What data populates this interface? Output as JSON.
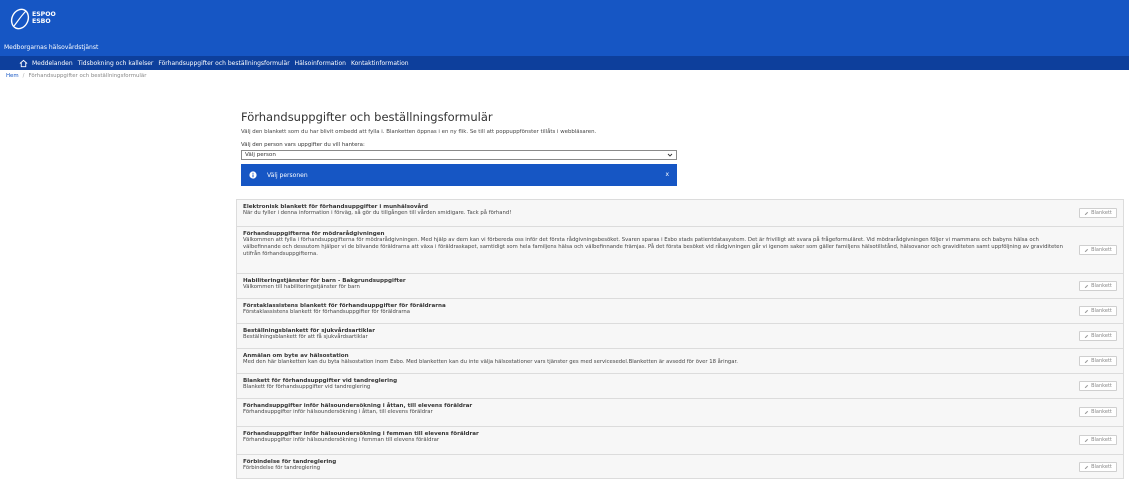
{
  "logo": {
    "line1": "ESPOO",
    "line2": "ESBO"
  },
  "header": {
    "site_name": "Medborgarnas hälsovårdstjänst"
  },
  "nav": {
    "items": [
      "Meddelanden",
      "Tidsbokning och kallelser",
      "Förhandsuppgifter och beställningsformulär",
      "Hälsoinformation",
      "Kontaktinformation"
    ]
  },
  "breadcrumb": {
    "home": "Hem",
    "sep": "/",
    "current": "Förhandsuppgifter och beställningsformulär"
  },
  "page": {
    "title": "Förhandsuppgifter och beställningsformulär",
    "intro": "Välj den blankett som du har blivit ombedd att fylla i. Blanketten öppnas i en ny flik. Se till att poppuppfönster tillåts i webbläsaren.",
    "select_label": "Välj den person vars uppgifter du vill hantera:",
    "select_value": "Välj person",
    "alert_text": "Välj personen",
    "alert_close": "x"
  },
  "forms": [
    {
      "title": "Elektronisk blankett för förhandsuppgifter i munhälsovård",
      "desc": "När du fyller i denna information i förväg, så gör du tillgången till vården smidigare. Tack på förhand!",
      "button": "Blankett"
    },
    {
      "title": "Förhandsuppgifterna för mödrarådgivningen",
      "desc": "Välkommen att fylla i förhandsuppgifterna för mödrarådgivningen. Med hjälp av dem kan vi förbereda oss inför det första rådgivningsbesöket. Svaren sparas i Esbo stads patientdatasystem. Det är frivilligt att svara på frågeformuläret. Vid mödrarådgivningen följer vi mammans och babyns hälsa och välbefinnande och dessutom hjälper vi de blivande föräldrarna att växa i föräldraskapet, samtidigt som hela familjens hälsa och välbefinnande främjas. På det första besöket vid rådgivningen går vi igenom saker som gäller familjens hälsotillstånd, hälsovanor och graviditeten samt uppföljning av graviditeten utifrån förhandsuppgifterna.",
      "button": "Blankett"
    },
    {
      "title": "Habiliteringstjänster för barn - Bakgrundsuppgifter",
      "desc": "Välkommen till habiliteringstjänster för barn",
      "button": "Blankett"
    },
    {
      "title": "Förstaklassistens blankett för förhandsuppgifter för föräldrarna",
      "desc": "Förstaklassistens blankett för förhandsuppgifter för föräldrarna",
      "button": "Blankett"
    },
    {
      "title": "Beställningsblankett för sjukvårdsartiklar",
      "desc": "Beställningsblankett för att få sjukvårdsartiklar",
      "button": "Blankett"
    },
    {
      "title": "Anmälan om byte av hälsostation",
      "desc": "Med den här blanketten kan du byta hälsostation inom Esbo. Med blanketten kan du inte välja hälsostationer vars tjänster ges med servicesedel.Blanketten är avsedd för över 18 åringar.",
      "button": "Blankett"
    },
    {
      "title": "Blankett för förhandsuppgifter vid tandreglering",
      "desc": "Blankett för förhandsuppgifter vid tandreglering",
      "button": "Blankett"
    },
    {
      "title": "Förhandsuppgifter inför hälsoundersökning i åttan, till elevens föräldrar",
      "desc": "Förhandsuppgifter inför hälsoundersökning i åttan, till elevens föräldrar",
      "button": "Blankett"
    },
    {
      "title": "Förhandsuppgifter inför hälsoundersökning i femman till elevens föräldrar",
      "desc": "Förhandsuppgifter inför hälsoundersökning i femman till elevens föräldrar",
      "button": "Blankett"
    },
    {
      "title": "Förbindelse för tandreglering",
      "desc": "Förbindelse för tandreglering",
      "button": "Blankett"
    }
  ],
  "colors": {
    "brand_blue": "#1656c4",
    "nav_blue": "#0d3f9c"
  },
  "icons": {
    "home": "home-icon",
    "info": "info-icon",
    "chevron": "chevron-down-icon",
    "pencil": "pencil-icon"
  }
}
